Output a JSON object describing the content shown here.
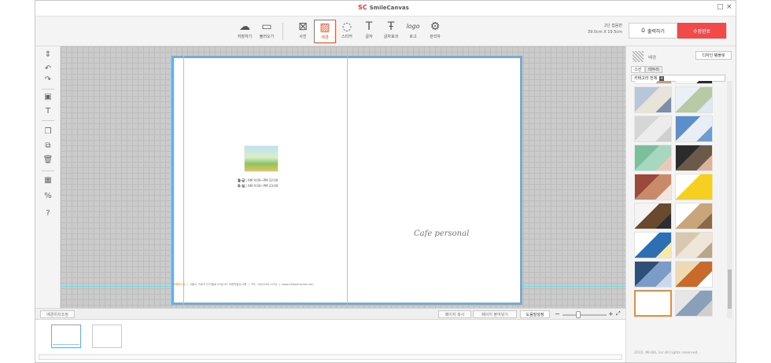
{
  "app": {
    "title": "SmileCanvas",
    "logo": "SC"
  },
  "window_controls": [
    "□",
    "×"
  ],
  "toolbar": {
    "tools": [
      {
        "label": "저장하기",
        "icon": "cloud-upload-icon",
        "glyph": "☁"
      },
      {
        "label": "불러오기",
        "icon": "folder-icon",
        "glyph": "▭"
      },
      {
        "label": "사진",
        "icon": "photo-icon",
        "glyph": "⊠"
      },
      {
        "label": "배경",
        "icon": "background-icon",
        "glyph": "▨"
      },
      {
        "label": "스티커",
        "icon": "sticker-icon",
        "glyph": "◌"
      },
      {
        "label": "글자",
        "icon": "text-icon",
        "glyph": "T"
      },
      {
        "label": "글자효과",
        "icon": "text-effect-icon",
        "glyph": "Ŧ"
      },
      {
        "label": "로고",
        "icon": "logo-icon",
        "glyph": "logo"
      },
      {
        "label": "관리자",
        "icon": "admin-icon",
        "glyph": "⚙"
      }
    ],
    "active_tool": "배경",
    "size_info": {
      "line1": "2단 접음면",
      "line2": "39.0cm X 19.5cm"
    },
    "print_label": "출력하기",
    "done_label": "수정완료"
  },
  "left_tools": [
    {
      "icon": "align-icon",
      "glyph": "⇕"
    },
    {
      "icon": "undo-icon",
      "glyph": "↶"
    },
    {
      "icon": "redo-icon",
      "glyph": "↷"
    },
    {
      "icon": "add-photo-icon",
      "glyph": "▣"
    },
    {
      "icon": "add-text-icon",
      "glyph": "T"
    },
    {
      "icon": "layer-front-icon",
      "glyph": "❐"
    },
    {
      "icon": "copy-icon",
      "glyph": "⧉"
    },
    {
      "icon": "delete-icon",
      "glyph": "🗑"
    },
    {
      "icon": "grid-icon",
      "glyph": "▦"
    },
    {
      "icon": "zoom-percent-icon",
      "glyph": "%"
    },
    {
      "icon": "help-icon",
      "glyph": "?"
    }
  ],
  "canvas": {
    "hours_line1_label": "월-금",
    "hours_line1_value": "AM 9:00~PM 22:00",
    "hours_line2_label": "토-일",
    "hours_line2_value": "AM 9:00~PM 23:00",
    "brand_text": "Cafe personal",
    "footer_brand": "카페퍼스널",
    "footer_address": "서울시 구로구 디지털로 00길 00 오렌지빌딩 0층",
    "footer_tel": "TEL. 02)0000-1234",
    "footer_web": "www.cafepersonal.com"
  },
  "statusbar": {
    "left_button": "배경위치조정",
    "copy_page": "페이지 복사",
    "paste_page": "페이지 붙여넣기",
    "help_settings": "도움말설정",
    "zoom_minus": "−",
    "zoom_plus": "+",
    "zoom_level": 0.35
  },
  "right_panel": {
    "title": "배경",
    "design_template_button": "디자인 템플릿",
    "tabs": [
      "스킨",
      "테두리"
    ],
    "active_tab": "스킨",
    "category_filter": "카테고리 전체",
    "swatches": [
      {
        "a": "#f0eee9",
        "b": "#ffffff",
        "c": "#c8a07a"
      },
      {
        "a": "#e9eef6",
        "b": "#f7f7f7",
        "c": "#2a2a2a"
      },
      {
        "a": "#b9c6d9",
        "b": "#e8e4da",
        "c": "#7d8fa6"
      },
      {
        "a": "#eaf0f5",
        "b": "#b8c9a5",
        "c": "#dfe8ef"
      },
      {
        "a": "#d6d6d6",
        "b": "#ececec",
        "c": "#cfcfcf"
      },
      {
        "a": "#5b8fcc",
        "b": "#e9eef6",
        "c": "#6e9dd4"
      },
      {
        "a": "#7bbf9c",
        "b": "#a6d8c0",
        "c": "#e9c9b8"
      },
      {
        "a": "#2b2b2b",
        "b": "#6b5a4a",
        "c": "#d8b49a"
      },
      {
        "a": "#9a4a3a",
        "b": "#c98a6a",
        "c": "#f2e6dc"
      },
      {
        "a": "#ffffff",
        "b": "#f5d020",
        "c": "#f5d020"
      },
      {
        "a": "#f4f4f4",
        "b": "#6a4a2e",
        "c": "#2e2e2e"
      },
      {
        "a": "#ffffff",
        "b": "#c8a57a",
        "c": "#8a6a4a"
      },
      {
        "a": "#ffffff",
        "b": "#2e6fb3",
        "c": "#f7e9a8"
      },
      {
        "a": "#d8c8b0",
        "b": "#efe6d8",
        "c": "#b9a58a"
      },
      {
        "a": "#2e4f7a",
        "b": "#7a9cc6",
        "c": "#c9d8ea"
      },
      {
        "a": "#f0d9b0",
        "b": "#c86a2a",
        "c": "#ffffff"
      },
      {
        "a": "#ffffff",
        "b": "#ffffff",
        "c": "#ffffff"
      },
      {
        "a": "#e6e6e6",
        "b": "#8aa0b8",
        "c": "#cfcfcf"
      }
    ],
    "selected_swatch": 16,
    "copyright": "2015. Mirdih, Inc.All rights reserved."
  }
}
